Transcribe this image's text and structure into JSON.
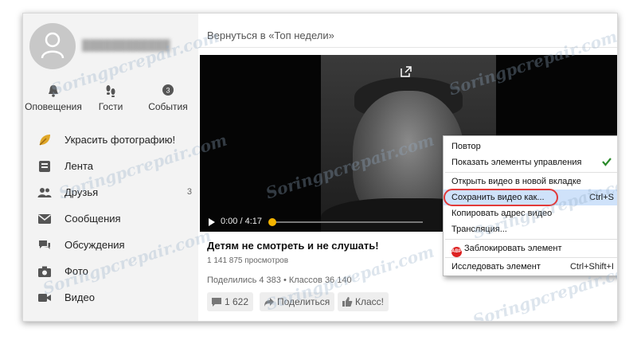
{
  "main": {
    "back_link": "Вернуться в «Топ недели»",
    "video": {
      "time": "0:00 / 4:17",
      "progress": 0.0,
      "title": "Детям не смотреть и не слушать!",
      "views": "1 141 875 просмотров",
      "stats": "Поделились 4 383  •  Классов 36 140"
    },
    "actions": {
      "comments": "1 622",
      "share": "Поделиться",
      "like": "Класс!"
    }
  },
  "sidebar": {
    "quick": [
      {
        "label": "Оповещения",
        "icon": "bell-icon"
      },
      {
        "label": "Гости",
        "icon": "footprints-icon"
      },
      {
        "label": "События",
        "icon": "events-icon",
        "badge": "3"
      }
    ],
    "items": [
      {
        "label": "Украсить фотографию!",
        "icon": "leaf-icon"
      },
      {
        "label": "Лента",
        "icon": "feed-icon"
      },
      {
        "label": "Друзья",
        "icon": "friends-icon",
        "count": "3"
      },
      {
        "label": "Сообщения",
        "icon": "mail-icon"
      },
      {
        "label": "Обсуждения",
        "icon": "chat-icon"
      },
      {
        "label": "Фото",
        "icon": "camera-icon"
      },
      {
        "label": "Видео",
        "icon": "video-icon"
      }
    ]
  },
  "context_menu": {
    "items": [
      {
        "label": "Повтор",
        "shortcut": ""
      },
      {
        "label": "Показать элементы управления",
        "shortcut": "",
        "checked": true
      },
      {
        "label": "Открыть видео в новой вкладке",
        "shortcut": ""
      },
      {
        "label": "Сохранить видео как...",
        "shortcut": "Ctrl+S",
        "highlighted": true
      },
      {
        "label": "Копировать адрес видео",
        "shortcut": ""
      },
      {
        "label": "Трансляция...",
        "shortcut": ""
      },
      {
        "label": "Заблокировать элемент",
        "shortcut": "",
        "icon": "adblock-icon",
        "icon_text": "ABP"
      },
      {
        "label": "Исследовать элемент",
        "shortcut": "Ctrl+Shift+I"
      }
    ]
  },
  "watermark": "Soringpcrepair.com",
  "colors": {
    "sidebar_bg": "#f3f3f3",
    "accent_orange": "#f4b400",
    "highlight_ring": "#e23a3a",
    "menu_highlight": "#cfe2fa"
  }
}
